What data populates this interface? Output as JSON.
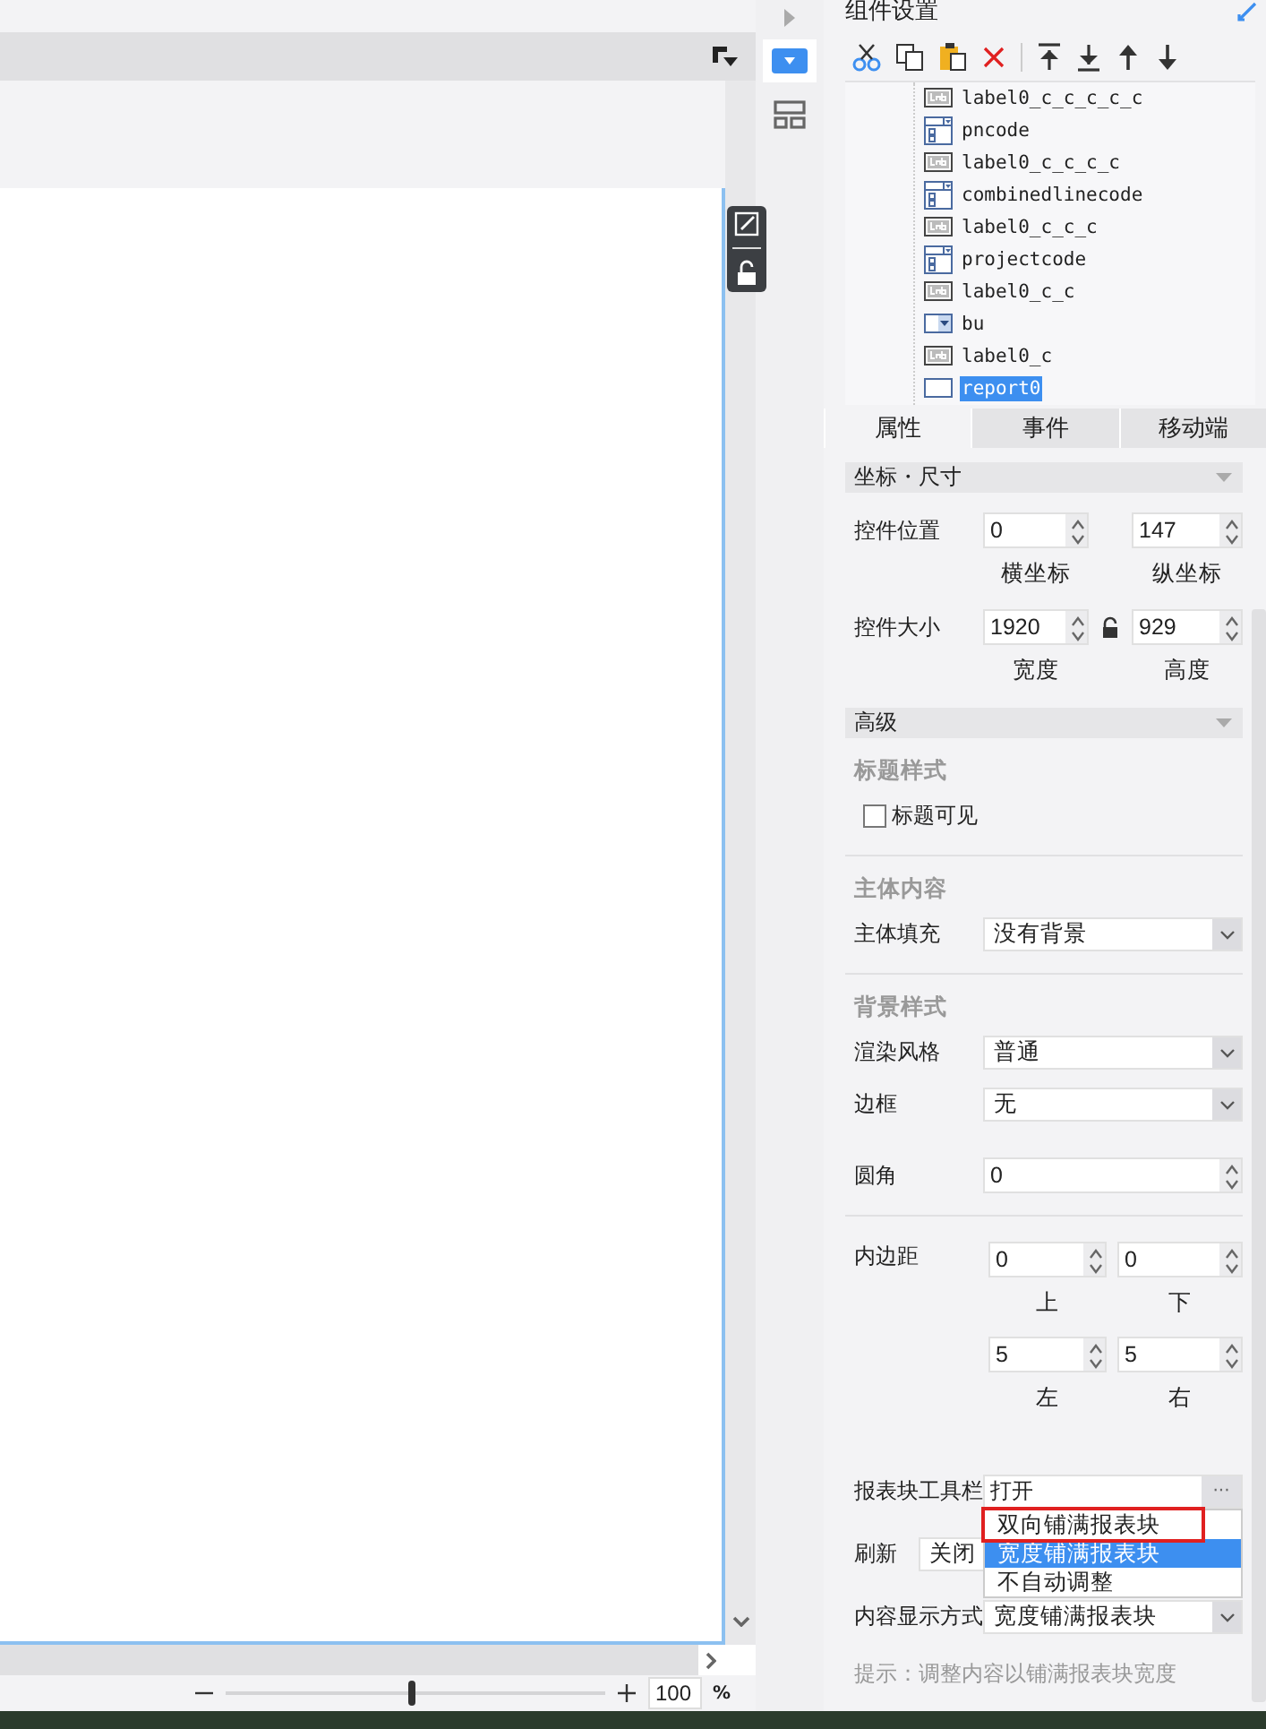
{
  "canvas": {
    "zoom": {
      "level": 0.49,
      "value": "100",
      "unit": "%"
    }
  },
  "side_tabs": [
    {
      "selected": true
    },
    {
      "selected": false
    }
  ],
  "panel": {
    "title": "组件设置",
    "tree": [
      {
        "label": "label0_c_c_c_c_c",
        "kind": "label",
        "selected": false
      },
      {
        "label": "pncode",
        "kind": "combo",
        "selected": false
      },
      {
        "label": "label0_c_c_c_c",
        "kind": "label",
        "selected": false
      },
      {
        "label": "combinedlinecode",
        "kind": "combo",
        "selected": false
      },
      {
        "label": "label0_c_c_c",
        "kind": "label",
        "selected": false
      },
      {
        "label": "projectcode",
        "kind": "combo",
        "selected": false
      },
      {
        "label": "label0_c_c",
        "kind": "label",
        "selected": false
      },
      {
        "label": "bu",
        "kind": "dropdown",
        "selected": false
      },
      {
        "label": "label0_c",
        "kind": "label",
        "selected": false
      },
      {
        "label": "report0",
        "kind": "report",
        "selected": true
      }
    ],
    "tabs": [
      {
        "label": "属性",
        "selected": true
      },
      {
        "label": "事件",
        "selected": false
      },
      {
        "label": "移动端",
        "selected": false
      }
    ],
    "position_size": {
      "title": "坐标・尺寸",
      "expanded": true,
      "rows": [
        {
          "label": "控件位置",
          "fields": [
            {
              "value": "0",
              "caption": "横坐标"
            },
            {
              "value": "147",
              "caption": "纵坐标"
            }
          ]
        },
        {
          "label": "控件大小",
          "lock": {
            "locked": false
          },
          "fields": [
            {
              "value": "1920",
              "caption": "宽度"
            },
            {
              "value": "929",
              "caption": "高度"
            }
          ]
        }
      ]
    },
    "advanced": {
      "title": "高级",
      "expanded": true,
      "sections": [
        {
          "title": "标题样式",
          "rows": [
            {
              "kind": "checkbox",
              "label": "标题可见",
              "checked": false
            }
          ]
        },
        {
          "title": "主体内容",
          "rows": [
            {
              "kind": "select",
              "label": "主体填充",
              "value": "没有背景"
            }
          ]
        },
        {
          "title": "背景样式",
          "rows": [
            {
              "kind": "select",
              "label": "渲染风格",
              "value": "普通"
            },
            {
              "kind": "select",
              "label": "边框",
              "value": "无"
            },
            {
              "kind": "spinner",
              "label": "圆角",
              "value": "0"
            }
          ]
        },
        {
          "rows": [
            {
              "kind": "padding",
              "label": "内边距",
              "fields": [
                {
                  "value": "0",
                  "caption": "上"
                },
                {
                  "value": "0",
                  "caption": "下"
                },
                {
                  "value": "5",
                  "caption": "左"
                },
                {
                  "value": "5",
                  "caption": "右"
                }
              ]
            }
          ]
        },
        {
          "rows": [
            {
              "kind": "picker",
              "label": "报表块工具栏",
              "value": "打开",
              "button": "···"
            },
            {
              "kind": "select",
              "label": "刷新",
              "value": "关闭"
            },
            {
              "kind": "select",
              "label": "内容显示方式",
              "value": "宽度铺满报表块",
              "options": [
                {
                  "label": "双向铺满报表块",
                  "selected": false,
                  "outlined": true
                },
                {
                  "label": "宽度铺满报表块",
                  "selected": true,
                  "outlined": false
                },
                {
                  "label": "不自动调整",
                  "selected": false,
                  "outlined": false
                }
              ]
            }
          ],
          "hint": "提示：调整内容以铺满报表块宽度"
        }
      ]
    }
  }
}
